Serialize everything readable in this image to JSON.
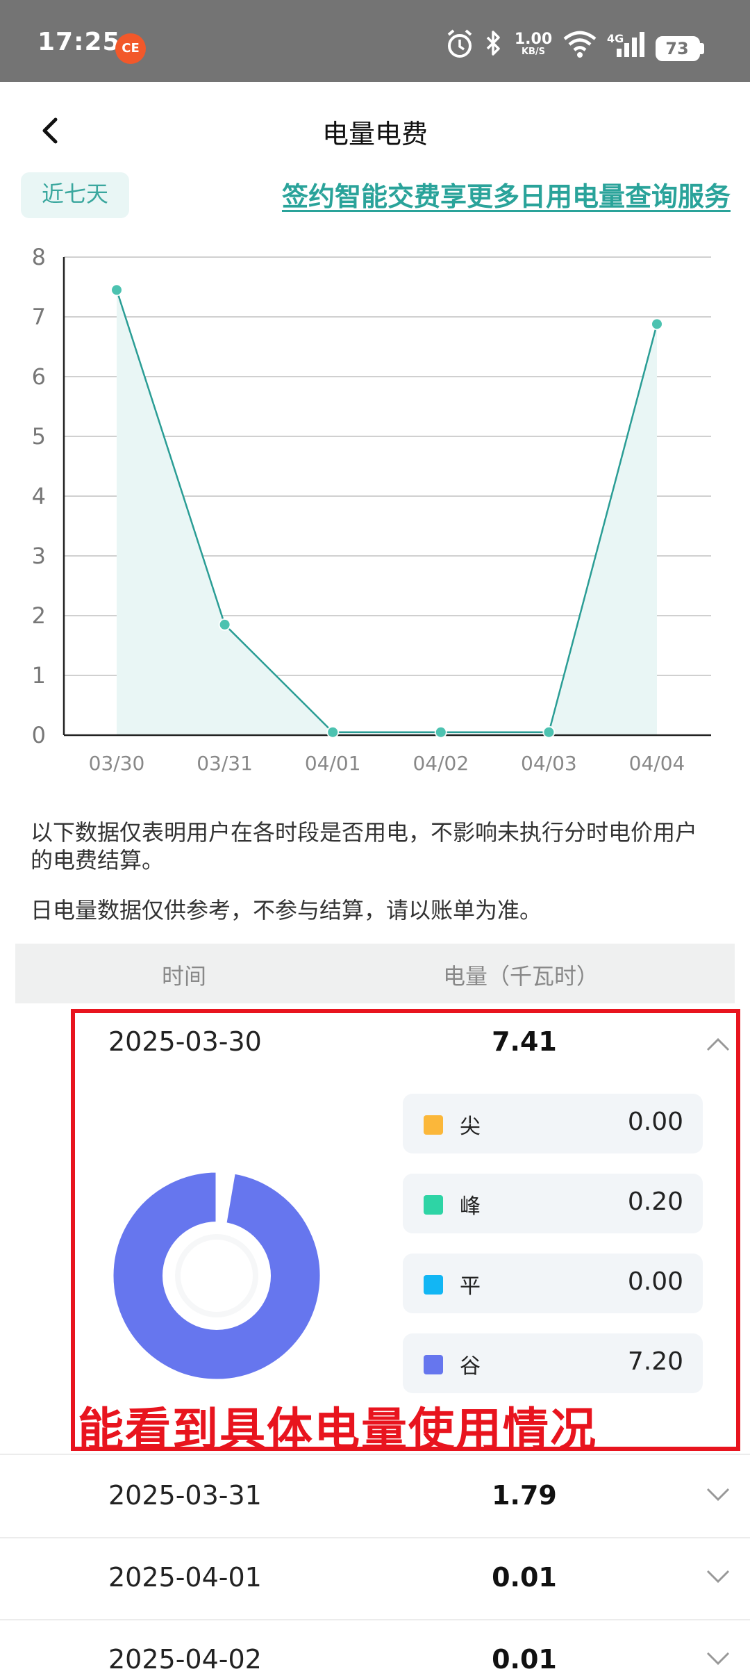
{
  "status_bar": {
    "time": "17:25",
    "app_icon_label": "CE",
    "network_speed": "1.00",
    "network_speed_unit": "KB/S",
    "network_type": "4G",
    "battery": "73",
    "icons": [
      "alarm-icon",
      "bluetooth-icon",
      "wifi-icon",
      "signal-icon",
      "battery-icon"
    ]
  },
  "header": {
    "title": "电量电费",
    "back_icon": "chevron-left-icon"
  },
  "filter": {
    "range_label": "近七天",
    "promo_link": "签约智能交费享更多日用电量查询服务"
  },
  "chart_data": {
    "type": "area",
    "categories": [
      "03/30",
      "03/31",
      "04/01",
      "04/02",
      "04/03",
      "04/04"
    ],
    "series": [
      {
        "values": [
          7.45,
          1.85,
          0.05,
          0.05,
          0.05,
          6.88
        ]
      }
    ],
    "ylim": [
      0,
      8
    ],
    "yticks": [
      0,
      1,
      2,
      3,
      4,
      5,
      6,
      7,
      8
    ],
    "grid": true,
    "colors": {
      "line": "#2a9d95",
      "fill": "#e9f6f5",
      "point": "#4cc2b0"
    }
  },
  "notes": [
    "以下数据仅表明用户在各时段是否用电，不影响未执行分时电价用户的电费结算。",
    "日电量数据仅供参考，不参与结算，请以账单为准。"
  ],
  "table": {
    "headers": [
      "时间",
      "电量（千瓦时）"
    ],
    "rows": [
      {
        "date": "2025-03-30",
        "value": "7.41",
        "expanded": true
      },
      {
        "date": "2025-03-31",
        "value": "1.79",
        "expanded": false
      },
      {
        "date": "2025-04-01",
        "value": "0.01",
        "expanded": false
      },
      {
        "date": "2025-04-02",
        "value": "0.01",
        "expanded": false
      }
    ]
  },
  "breakdown": {
    "items": [
      {
        "label": "尖",
        "value": "0.00",
        "color": "#fbb73a"
      },
      {
        "label": "峰",
        "value": "0.20",
        "color": "#2ed4a5"
      },
      {
        "label": "平",
        "value": "0.00",
        "color": "#12b6f4"
      },
      {
        "label": "谷",
        "value": "7.20",
        "color": "#6676ee"
      }
    ],
    "donut_fractions": [
      0.0,
      0.027,
      0.0,
      0.973
    ]
  },
  "annotation": {
    "text": "能看到具体电量使用情况",
    "color": "#e8141e"
  }
}
